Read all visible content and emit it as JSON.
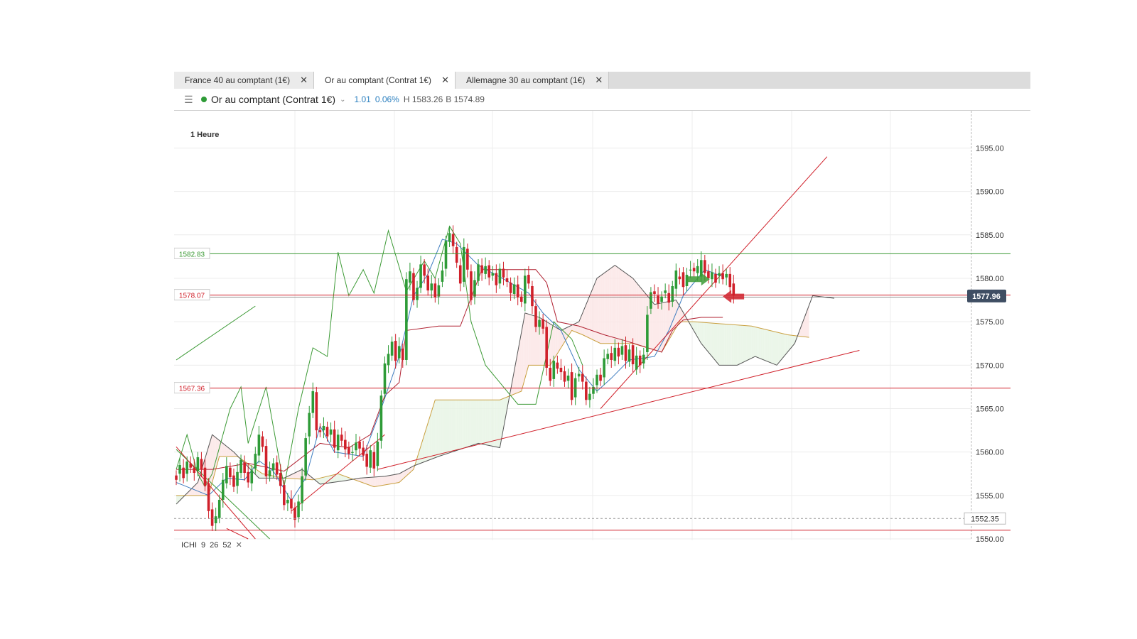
{
  "tabs": [
    {
      "label": "France 40 au comptant (1€)",
      "active": false
    },
    {
      "label": "Or au comptant (Contrat 1€)",
      "active": true
    },
    {
      "label": "Allemagne 30 au comptant (1€)",
      "active": false
    }
  ],
  "tab_close_glyph": "✕",
  "header": {
    "instrument": "Or au comptant (Contrat 1€)",
    "change": "1.01",
    "change_pct": "0.06%",
    "high": "H 1583.26",
    "bid": "B 1574.89",
    "status_color": "#2e9b37",
    "icons": {
      "menu": "hamburger-icon",
      "chevron": "chevron-down-icon"
    }
  },
  "indicator": {
    "name": "ICHI",
    "params": [
      "9",
      "26",
      "52"
    ],
    "close_glyph": "✕"
  },
  "colors": {
    "up": "#2e9b37",
    "down": "#d0202a",
    "tenkan": "#3b7bbf",
    "kijun": "#b02030",
    "chikou": "#3c9a35",
    "span_a": "#c9a040",
    "span_b": "#555555",
    "price_tag": "#3f4e63"
  },
  "chart_data": {
    "type": "candlestick",
    "timeframe": "1 Heure",
    "ylim": [
      1550,
      1597
    ],
    "yticks": [
      "1595.00",
      "1590.00",
      "1585.00",
      "1580.00",
      "1575.00",
      "1570.00",
      "1565.00",
      "1560.00",
      "1555.00",
      "1550.00"
    ],
    "last_price": "1577.96",
    "dashed_level": "1552.35",
    "levels": [
      {
        "value": 1582.83,
        "label": "1582.83",
        "color": "#3c9a35"
      },
      {
        "value": 1578.07,
        "label": "1578.07",
        "color": "#d0202a"
      },
      {
        "value": 1567.36,
        "label": "1567.36",
        "color": "#d0202a"
      },
      {
        "value": 1551.0,
        "label": "",
        "color": "#d0202a"
      }
    ],
    "candles": [
      [
        1557.3,
        1556.8
      ],
      [
        1557.5,
        1558.5
      ],
      [
        1558.2,
        1557.0
      ],
      [
        1557.5,
        1558.9
      ],
      [
        1558.7,
        1558.2
      ],
      [
        1558.2,
        1557.6
      ],
      [
        1557.8,
        1559.4
      ],
      [
        1559.2,
        1558.0
      ],
      [
        1558.2,
        1556.1
      ],
      [
        1556.4,
        1553.2
      ],
      [
        1553.4,
        1551.5
      ],
      [
        1551.8,
        1552.6
      ],
      [
        1552.4,
        1554.5
      ],
      [
        1554.5,
        1556.8
      ],
      [
        1556.4,
        1558.4
      ],
      [
        1558.2,
        1557.1
      ],
      [
        1557.3,
        1556.0
      ],
      [
        1556.1,
        1557.7
      ],
      [
        1557.6,
        1559.1
      ],
      [
        1558.8,
        1557.6
      ],
      [
        1557.7,
        1556.5
      ],
      [
        1556.4,
        1557.9
      ],
      [
        1558.1,
        1559.8
      ],
      [
        1559.6,
        1562.0
      ],
      [
        1561.8,
        1560.6
      ],
      [
        1560.7,
        1557.2
      ],
      [
        1557.2,
        1557.9
      ],
      [
        1557.9,
        1558.7
      ],
      [
        1558.8,
        1557.4
      ],
      [
        1557.6,
        1556.1
      ],
      [
        1556.2,
        1553.9
      ],
      [
        1554.1,
        1554.5
      ],
      [
        1554.6,
        1553.5
      ],
      [
        1553.6,
        1552.2
      ],
      [
        1552.5,
        1554.3
      ],
      [
        1554.1,
        1557.2
      ],
      [
        1557.3,
        1561.6
      ],
      [
        1561.8,
        1564.5
      ],
      [
        1564.5,
        1567.0
      ],
      [
        1566.9,
        1562.5
      ],
      [
        1562.5,
        1562.3
      ],
      [
        1562.5,
        1563.0
      ],
      [
        1562.9,
        1561.8
      ],
      [
        1562.0,
        1562.6
      ],
      [
        1562.6,
        1560.5
      ],
      [
        1560.2,
        1562.0
      ],
      [
        1562.0,
        1561.3
      ],
      [
        1561.4,
        1560.3
      ],
      [
        1560.6,
        1559.8
      ],
      [
        1559.9,
        1560.0
      ],
      [
        1560.2,
        1561.1
      ],
      [
        1561.2,
        1560.4
      ],
      [
        1560.5,
        1559.6
      ],
      [
        1559.8,
        1558.3
      ],
      [
        1558.2,
        1560.2
      ],
      [
        1560.0,
        1558.1
      ],
      [
        1558.4,
        1561.2
      ],
      [
        1561.3,
        1566.5
      ],
      [
        1566.7,
        1570.2
      ],
      [
        1570.0,
        1571.3
      ],
      [
        1571.1,
        1572.7
      ],
      [
        1572.8,
        1570.5
      ],
      [
        1570.8,
        1572.2
      ],
      [
        1571.9,
        1570.6
      ],
      [
        1570.6,
        1579.9
      ],
      [
        1579.5,
        1580.8
      ],
      [
        1580.6,
        1577.5
      ],
      [
        1577.5,
        1578.9
      ],
      [
        1578.9,
        1581.6
      ],
      [
        1581.6,
        1580.3
      ],
      [
        1580.3,
        1578.6
      ],
      [
        1578.6,
        1579.4
      ],
      [
        1579.4,
        1577.8
      ],
      [
        1577.9,
        1579.2
      ],
      [
        1579.6,
        1580.9
      ],
      [
        1581.1,
        1584.3
      ],
      [
        1584.2,
        1585.2
      ],
      [
        1585.1,
        1583.7
      ],
      [
        1583.6,
        1581.8
      ],
      [
        1581.5,
        1579.4
      ],
      [
        1579.6,
        1583.6
      ],
      [
        1583.4,
        1581.0
      ],
      [
        1580.8,
        1577.5
      ],
      [
        1577.9,
        1579.8
      ],
      [
        1579.7,
        1581.6
      ],
      [
        1581.5,
        1580.6
      ],
      [
        1580.5,
        1581.4
      ],
      [
        1581.5,
        1580.1
      ],
      [
        1580.3,
        1580.6
      ],
      [
        1580.6,
        1579.2
      ],
      [
        1579.4,
        1581.1
      ],
      [
        1581.1,
        1580.1
      ],
      [
        1580.0,
        1579.6
      ],
      [
        1579.5,
        1578.3
      ],
      [
        1578.2,
        1579.3
      ],
      [
        1579.3,
        1577.8
      ],
      [
        1577.9,
        1577.3
      ],
      [
        1577.1,
        1580.3
      ],
      [
        1580.4,
        1579.4
      ],
      [
        1579.1,
        1576.8
      ],
      [
        1576.8,
        1574.4
      ],
      [
        1574.4,
        1575.2
      ],
      [
        1575.3,
        1574.2
      ],
      [
        1574.4,
        1569.7
      ],
      [
        1569.7,
        1568.2
      ],
      [
        1568.4,
        1570.5
      ],
      [
        1570.3,
        1569.6
      ],
      [
        1569.7,
        1569.2
      ],
      [
        1569.3,
        1568.1
      ],
      [
        1568.2,
        1568.8
      ],
      [
        1569.2,
        1566.0
      ],
      [
        1566.3,
        1568.5
      ],
      [
        1568.7,
        1569.0
      ],
      [
        1569.0,
        1568.1
      ],
      [
        1568.1,
        1566.0
      ],
      [
        1566.0,
        1566.7
      ],
      [
        1566.7,
        1567.5
      ],
      [
        1567.7,
        1568.9
      ],
      [
        1568.9,
        1568.2
      ],
      [
        1568.6,
        1570.8
      ],
      [
        1570.7,
        1571.3
      ],
      [
        1571.4,
        1570.6
      ],
      [
        1570.5,
        1572.0
      ],
      [
        1572.0,
        1571.0
      ],
      [
        1571.2,
        1572.2
      ],
      [
        1572.3,
        1570.5
      ],
      [
        1570.4,
        1571.8
      ],
      [
        1572.3,
        1570.1
      ],
      [
        1569.5,
        1571.1
      ],
      [
        1571.1,
        1570.0
      ],
      [
        1570.2,
        1571.2
      ],
      [
        1571.5,
        1575.8
      ],
      [
        1576.5,
        1578.4
      ],
      [
        1578.5,
        1578.2
      ],
      [
        1578.0,
        1577.1
      ],
      [
        1577.3,
        1577.9
      ],
      [
        1578.3,
        1578.6
      ],
      [
        1578.3,
        1577.2
      ],
      [
        1577.3,
        1579.1
      ],
      [
        1578.8,
        1580.9
      ],
      [
        1580.2,
        1579.9
      ],
      [
        1580.7,
        1579.0
      ],
      [
        1579.1,
        1580.4
      ],
      [
        1580.9,
        1581.0
      ],
      [
        1581.2,
        1580.8
      ],
      [
        1580.6,
        1581.4
      ],
      [
        1580.2,
        1582.1
      ],
      [
        1582.1,
        1580.6
      ],
      [
        1580.8,
        1580.0
      ],
      [
        1579.9,
        1580.7
      ],
      [
        1580.5,
        1579.5
      ],
      [
        1580.3,
        1580.6
      ],
      [
        1580.6,
        1579.9
      ],
      [
        1580.1,
        1580.5
      ],
      [
        1580.5,
        1579.0
      ],
      [
        1579.4,
        1578.0
      ]
    ],
    "tenkan": [
      [
        0,
        1556.5
      ],
      [
        9,
        1555.0
      ],
      [
        14,
        1557.0
      ],
      [
        19,
        1556.8
      ],
      [
        23,
        1559.0
      ],
      [
        27,
        1557.8
      ],
      [
        32,
        1554.4
      ],
      [
        36,
        1557.0
      ],
      [
        40,
        1563.0
      ],
      [
        44,
        1560.0
      ],
      [
        52,
        1559.5
      ],
      [
        57,
        1565.0
      ],
      [
        62,
        1571.0
      ],
      [
        66,
        1578.0
      ],
      [
        70,
        1580.5
      ],
      [
        74,
        1584.5
      ],
      [
        78,
        1584.0
      ],
      [
        84,
        1581.5
      ],
      [
        92,
        1579.7
      ],
      [
        98,
        1578.3
      ],
      [
        102,
        1576.0
      ],
      [
        107,
        1574.0
      ],
      [
        112,
        1569.5
      ],
      [
        117,
        1567.0
      ],
      [
        121,
        1568.5
      ],
      [
        126,
        1570.6
      ],
      [
        133,
        1571.0
      ],
      [
        137,
        1574.0
      ],
      [
        141,
        1578.0
      ],
      [
        147,
        1581.0
      ],
      [
        152,
        1580.2
      ]
    ],
    "kijun": [
      [
        0,
        1558.0
      ],
      [
        10,
        1558.0
      ],
      [
        20,
        1558.7
      ],
      [
        30,
        1557.8
      ],
      [
        40,
        1561.0
      ],
      [
        48,
        1560.5
      ],
      [
        54,
        1562.0
      ],
      [
        58,
        1566.5
      ],
      [
        62,
        1568.0
      ],
      [
        64,
        1574.0
      ],
      [
        73,
        1574.5
      ],
      [
        79,
        1574.5
      ],
      [
        85,
        1581.0
      ],
      [
        93,
        1581.0
      ],
      [
        100,
        1581.0
      ],
      [
        103,
        1579.5
      ],
      [
        106,
        1575.0
      ],
      [
        112,
        1574.5
      ],
      [
        119,
        1573.5
      ],
      [
        125,
        1572.8
      ],
      [
        135,
        1571.5
      ],
      [
        138,
        1574.0
      ],
      [
        141,
        1575.2
      ],
      [
        146,
        1575.5
      ],
      [
        152,
        1575.5
      ]
    ],
    "chikou": [
      [
        0,
        1558.0
      ],
      [
        3,
        1562.0
      ],
      [
        6,
        1557.5
      ],
      [
        8,
        1556.0
      ],
      [
        10,
        1557.5
      ],
      [
        15,
        1565.0
      ],
      [
        18,
        1567.5
      ],
      [
        20,
        1561.0
      ],
      [
        25,
        1567.5
      ],
      [
        30,
        1556.0
      ],
      [
        34,
        1565.0
      ],
      [
        38,
        1572.0
      ],
      [
        42,
        1571.0
      ],
      [
        45,
        1583.0
      ],
      [
        48,
        1578.0
      ],
      [
        52,
        1581.0
      ],
      [
        55,
        1578.3
      ],
      [
        59,
        1585.5
      ],
      [
        64,
        1578.5
      ],
      [
        69,
        1582.0
      ],
      [
        72,
        1580.0
      ],
      [
        76,
        1586.0
      ],
      [
        79,
        1584.0
      ],
      [
        82,
        1575.0
      ],
      [
        86,
        1570.0
      ],
      [
        91,
        1567.5
      ],
      [
        95,
        1565.5
      ],
      [
        100,
        1565.5
      ],
      [
        105,
        1575.0
      ],
      [
        110,
        1573.0
      ],
      [
        113,
        1570.0
      ]
    ],
    "span_a": [
      [
        0,
        1555.0
      ],
      [
        9,
        1555.0
      ],
      [
        12,
        1559.5
      ],
      [
        17,
        1559.5
      ],
      [
        24,
        1557.5
      ],
      [
        30,
        1557.0
      ],
      [
        38,
        1556.8
      ],
      [
        45,
        1557.5
      ],
      [
        55,
        1556.0
      ],
      [
        62,
        1556.5
      ],
      [
        66,
        1558.0
      ],
      [
        72,
        1566.0
      ],
      [
        82,
        1566.0
      ],
      [
        90,
        1566.0
      ],
      [
        96,
        1567.0
      ],
      [
        98,
        1570.0
      ],
      [
        104,
        1570.0
      ],
      [
        110,
        1574.0
      ],
      [
        113,
        1573.5
      ],
      [
        118,
        1572.5
      ],
      [
        127,
        1572.5
      ],
      [
        135,
        1571.5
      ],
      [
        140,
        1575.0
      ],
      [
        144,
        1575.0
      ],
      [
        160,
        1574.5
      ],
      [
        170,
        1573.5
      ],
      [
        176,
        1573.2
      ]
    ],
    "span_b": [
      [
        0,
        1554.0
      ],
      [
        6,
        1556.5
      ],
      [
        10,
        1562.0
      ],
      [
        16,
        1560.0
      ],
      [
        23,
        1557.0
      ],
      [
        30,
        1557.0
      ],
      [
        35,
        1558.0
      ],
      [
        40,
        1556.3
      ],
      [
        47,
        1556.7
      ],
      [
        51,
        1557.0
      ],
      [
        58,
        1557.2
      ],
      [
        62,
        1557.5
      ],
      [
        66,
        1558.4
      ],
      [
        73,
        1559.5
      ],
      [
        84,
        1561.0
      ],
      [
        90,
        1560.5
      ],
      [
        97,
        1576.0
      ],
      [
        101,
        1575.5
      ],
      [
        107,
        1574.0
      ],
      [
        112,
        1575.0
      ],
      [
        117,
        1580.0
      ],
      [
        122,
        1581.5
      ],
      [
        127,
        1580.0
      ],
      [
        133,
        1577.0
      ],
      [
        139,
        1577.5
      ],
      [
        146,
        1572.5
      ],
      [
        151,
        1570.0
      ],
      [
        156,
        1570.0
      ],
      [
        161,
        1571.0
      ],
      [
        167,
        1570.0
      ],
      [
        172,
        1572.5
      ],
      [
        177,
        1578.0
      ],
      [
        183,
        1577.7
      ]
    ],
    "trendlines": [
      {
        "from": [
          0,
          1570.6
        ],
        "to": [
          22,
          1576.8
        ],
        "color": "#3c9a35"
      },
      {
        "from": [
          0,
          1560.3
        ],
        "to": [
          26,
          1550.0
        ],
        "color": "#3c9a35"
      },
      {
        "from": [
          0,
          1560.6
        ],
        "to": [
          22,
          1550.0
        ],
        "color": "#d0202a"
      },
      {
        "from": [
          14,
          1551.2
        ],
        "to": [
          20,
          1550.0
        ],
        "color": "#d0202a"
      },
      {
        "from": [
          32,
          1553.2
        ],
        "to": [
          58,
          1562.0
        ],
        "color": "#d0202a"
      },
      {
        "from": [
          56,
          1558.0
        ],
        "to": [
          190,
          1571.7
        ],
        "color": "#d0202a"
      },
      {
        "from": [
          118,
          1565.0
        ],
        "to": [
          181,
          1594.0
        ],
        "color": "#d0202a"
      }
    ],
    "arrows": [
      {
        "x": 146,
        "y": 1579.9,
        "direction": "right",
        "color": "#3c9a35"
      },
      {
        "x": 152,
        "y": 1577.9,
        "direction": "left",
        "color": "#d0202a"
      }
    ]
  }
}
